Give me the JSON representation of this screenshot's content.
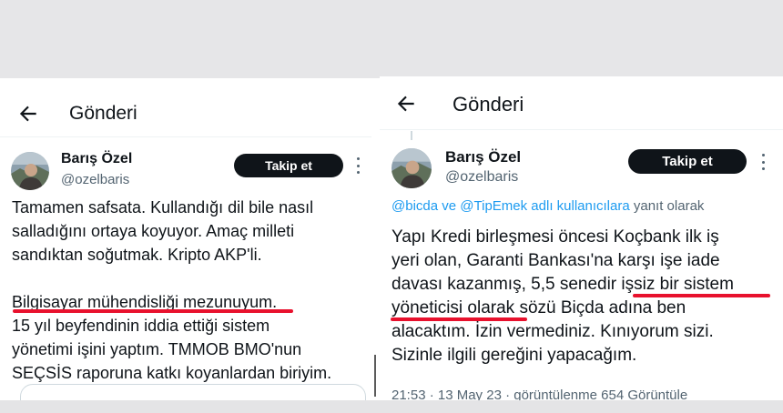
{
  "left": {
    "header": {
      "title": "Gönderi"
    },
    "author": {
      "name": "Barış Özel",
      "handle": "@ozelbaris"
    },
    "follow_label": "Takip et",
    "text_lines": [
      "Tamamen safsata. Kullandığı dil bile nasıl",
      "salladığını ortaya koyuyor. Amaç milleti",
      "sandıktan soğutmak. Kripto AKP'li.",
      "",
      "Bilgisayar mühendisliği mezunuyum.",
      "15 yıl beyfendinin iddia ettiği sistem",
      "yönetimi işini yaptım. TMMOB BMO'nun",
      "SEÇSİS raporuna katkı koyanlardan biriyim."
    ]
  },
  "right": {
    "header": {
      "title": "Gönderi"
    },
    "author": {
      "name": "Barış Özel",
      "handle": "@ozelbaris"
    },
    "follow_label": "Takip et",
    "reply_to": {
      "mention1": "@bicda",
      "and_word": " ve ",
      "mention2": "@TipEmek adlı kullanıcılara",
      "suffix": " yanıt olarak"
    },
    "text_lines": [
      "Yapı Kredi birleşmesi öncesi Koçbank ilk iş",
      "yeri olan, Garanti Bankası'na karşı işe iade",
      "davası kazanmış, 5,5 senedir işsiz bir sistem",
      "yöneticisi olarak sözü Biçda adına ben",
      "alacaktım. İzin vermediniz. Kınıyorum sizi.",
      "Sizinle ilgili gereğini yapacağım."
    ],
    "timestamp_partial": "21:53 · 13 May 23 · görüntülenme 654 Görüntüle"
  },
  "colors": {
    "underline": "#e8112d",
    "mention": "#1d9bf0",
    "follow_bg": "#0f1419",
    "secondary_text": "#536471"
  },
  "icons": {
    "back": "arrow-left-icon",
    "more": "more-vertical-icon",
    "avatar": "avatar"
  }
}
